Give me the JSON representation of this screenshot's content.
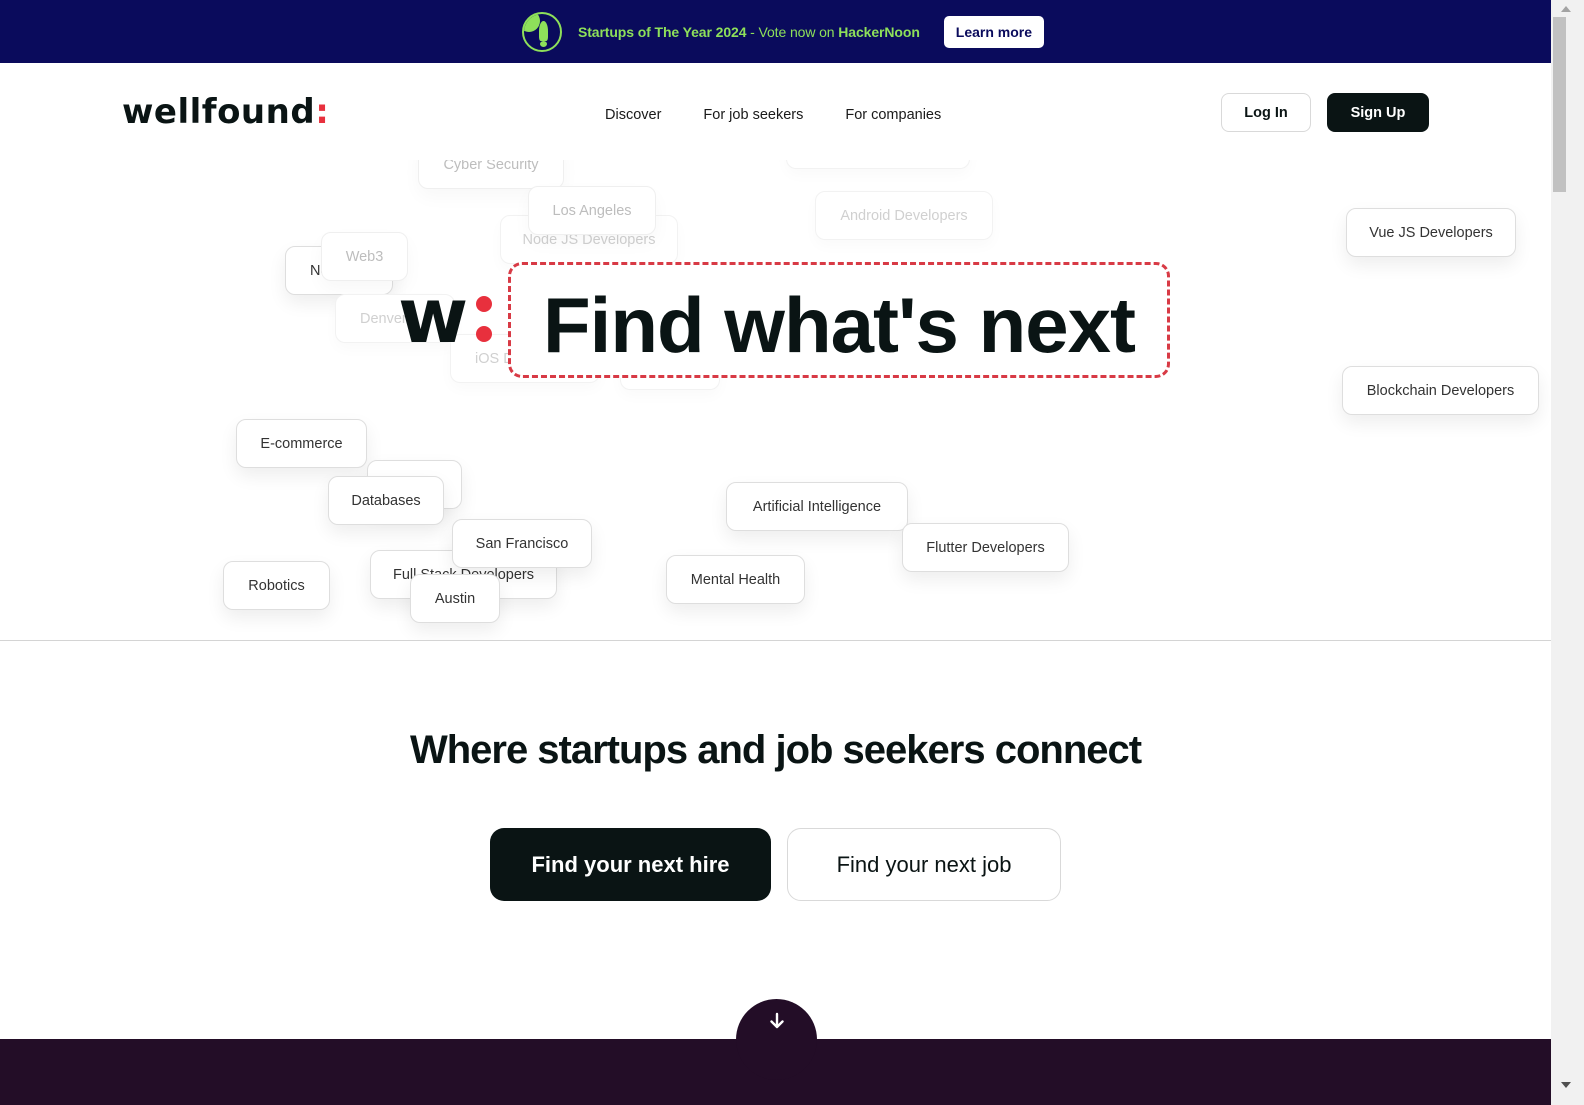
{
  "banner": {
    "icon": "hackernoon-rocket-icon",
    "highlight": "Startups of The Year 2024",
    "middle": " - Vote now on ",
    "brand": "HackerNoon",
    "button_label": "Learn more",
    "colors": {
      "background": "#0a0b5c",
      "accent": "#8ee05a"
    }
  },
  "header": {
    "logo_text": "wellfound",
    "logo_colon": ":",
    "nav": [
      {
        "label": "Discover"
      },
      {
        "label": "For job seekers"
      },
      {
        "label": "For companies"
      }
    ],
    "login_label": "Log In",
    "signup_label": "Sign Up"
  },
  "hero": {
    "mark_letter": "w",
    "headline": "Find what's next",
    "chips": [
      {
        "label": "Cyber Security",
        "style": "faded"
      },
      {
        "label": "",
        "style": "faded2"
      },
      {
        "label": "Los Angeles",
        "style": "faded"
      },
      {
        "label": "Node JS Developers",
        "style": "faded2"
      },
      {
        "label": "Android Developers",
        "style": "faded2"
      },
      {
        "label": "Vue JS Developers",
        "style": "normal"
      },
      {
        "label": "No",
        "style": "normal"
      },
      {
        "label": "Web3",
        "style": "faded"
      },
      {
        "label": "Denver",
        "style": "faded2"
      },
      {
        "label": "iOS D",
        "style": "faded2"
      },
      {
        "label": "Blockchain Developers",
        "style": "normal"
      },
      {
        "label": "E-commerce",
        "style": "normal"
      },
      {
        "label": "",
        "style": "normal"
      },
      {
        "label": "Databases",
        "style": "normal"
      },
      {
        "label": "Artificial Intelligence",
        "style": "normal"
      },
      {
        "label": "Flutter Developers",
        "style": "normal"
      },
      {
        "label": "Full Stack Developers",
        "style": "normal"
      },
      {
        "label": "San Francisco",
        "style": "normal"
      },
      {
        "label": "Mental Health",
        "style": "normal"
      },
      {
        "label": "Robotics",
        "style": "normal"
      },
      {
        "label": "Austin",
        "style": "normal"
      }
    ],
    "accent_color": "#e8303d"
  },
  "main": {
    "tagline": "Where startups and job seekers connect",
    "cta_hire": "Find your next hire",
    "cta_job": "Find your next job",
    "scroll_icon": "arrow-down-icon",
    "scroll_glyph": "↓"
  }
}
